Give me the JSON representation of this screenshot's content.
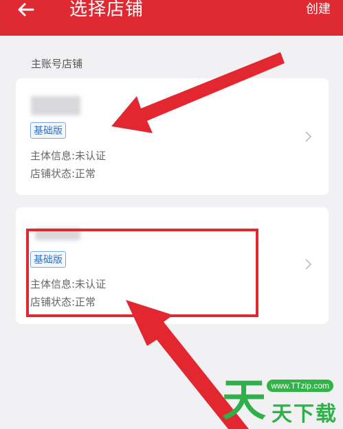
{
  "header": {
    "title": "选择店铺",
    "create_label": "创建",
    "back_icon": "arrow-left-icon",
    "background": "#e02a33"
  },
  "section_title": "主账号店铺",
  "stores": [
    {
      "badge": "基础版",
      "subject_info": "主体信息:未认证",
      "store_status": "店铺状态:正常"
    },
    {
      "badge": "基础版",
      "subject_info": "主体信息:未认证",
      "store_status": "店铺状态:正常"
    }
  ],
  "annotations": {
    "arrow_color": "#e32730",
    "highlight_color": "#e32730"
  },
  "watermark": {
    "url": "www.TTzip.com",
    "big_char": "天",
    "text": "天下载",
    "color": "#2fb04a"
  }
}
